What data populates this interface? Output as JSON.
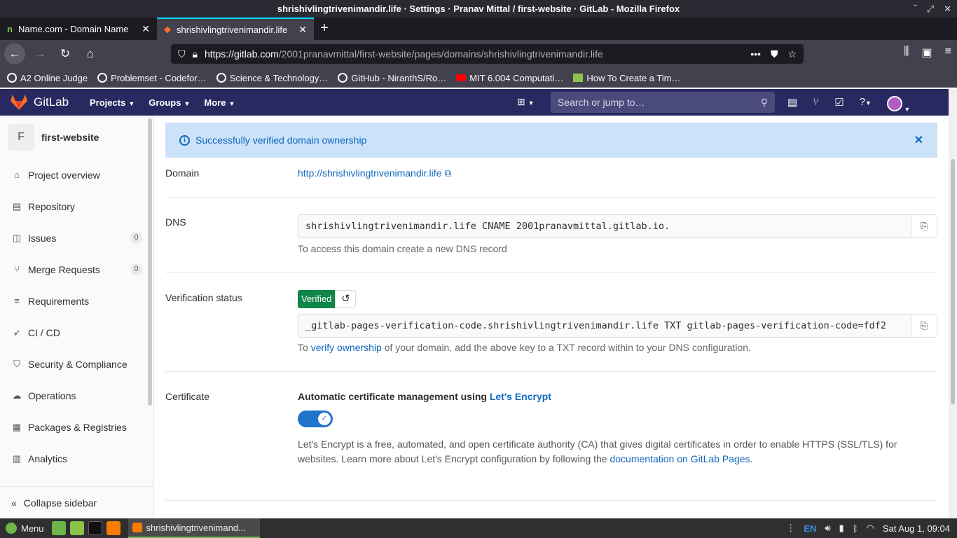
{
  "browser": {
    "title": "shrishivlingtrivenimandir.life · Settings · Pranav Mittal / first-website · GitLab - Mozilla Firefox",
    "tabs": [
      {
        "label": "Name.com - Domain Name"
      },
      {
        "label": "shrishivlingtrivenimandir.life"
      }
    ],
    "url_host": "https://gitlab.com",
    "url_path": "/2001pranavmittal/first-website/pages/domains/shrishivlingtrivenimandir.life",
    "bookmarks": [
      "A2 Online Judge",
      "Problemset - Codefor…",
      "Science & Technology…",
      "GitHub - NiranthS/Ro…",
      "MIT 6.004 Computati…",
      "How To Create a Tim…"
    ]
  },
  "gitlab": {
    "brand": "GitLab",
    "menu": [
      "Projects",
      "Groups",
      "More"
    ],
    "search_placeholder": "Search or jump to…"
  },
  "sidebar": {
    "project_initial": "F",
    "project_name": "first-website",
    "items": [
      {
        "label": "Project overview",
        "icon": "home-icon"
      },
      {
        "label": "Repository",
        "icon": "doc-icon"
      },
      {
        "label": "Issues",
        "icon": "issues-icon",
        "count": "0"
      },
      {
        "label": "Merge Requests",
        "icon": "merge-icon",
        "count": "0"
      },
      {
        "label": "Requirements",
        "icon": "requirements-icon"
      },
      {
        "label": "CI / CD",
        "icon": "rocket-icon"
      },
      {
        "label": "Security & Compliance",
        "icon": "shield-icon"
      },
      {
        "label": "Operations",
        "icon": "cloud-icon"
      },
      {
        "label": "Packages & Registries",
        "icon": "package-icon"
      },
      {
        "label": "Analytics",
        "icon": "chart-icon"
      }
    ],
    "collapse_label": "Collapse sidebar"
  },
  "alert": {
    "message": "Successfully verified domain ownership"
  },
  "domain": {
    "label": "Domain",
    "url": "http://shrishivlingtrivenimandir.life"
  },
  "dns": {
    "label": "DNS",
    "record": "shrishivlingtrivenimandir.life CNAME 2001pranavmittal.gitlab.io.",
    "help": "To access this domain create a new DNS record"
  },
  "verification": {
    "label": "Verification status",
    "badge": "Verified",
    "record": "_gitlab-pages-verification-code.shrishivlingtrivenimandir.life TXT gitlab-pages-verification-code=fdf2",
    "help_prefix": "To ",
    "help_link": "verify ownership",
    "help_suffix": " of your domain, add the above key to a TXT record within to your DNS configuration."
  },
  "certificate": {
    "label": "Certificate",
    "title_prefix": "Automatic certificate management using ",
    "title_link": "Let's Encrypt",
    "enabled": true,
    "desc_prefix": "Let's Encrypt is a free, automated, and open certificate authority (CA) that gives digital certificates in order to enable HTTPS (SSL/TLS) for websites. Learn more about Let's Encrypt configuration by following the ",
    "desc_link": "documentation on GitLab Pages",
    "desc_suffix": "."
  },
  "taskbar": {
    "menu_label": "Menu",
    "window_label": "shrishivlingtrivenimand...",
    "keyboard": "EN",
    "clock": "Sat Aug  1, 09:04"
  },
  "colors": {
    "gitlab_header": "#292961",
    "link": "#1068bf",
    "verified": "#108548",
    "toggle": "#1f75cb"
  }
}
